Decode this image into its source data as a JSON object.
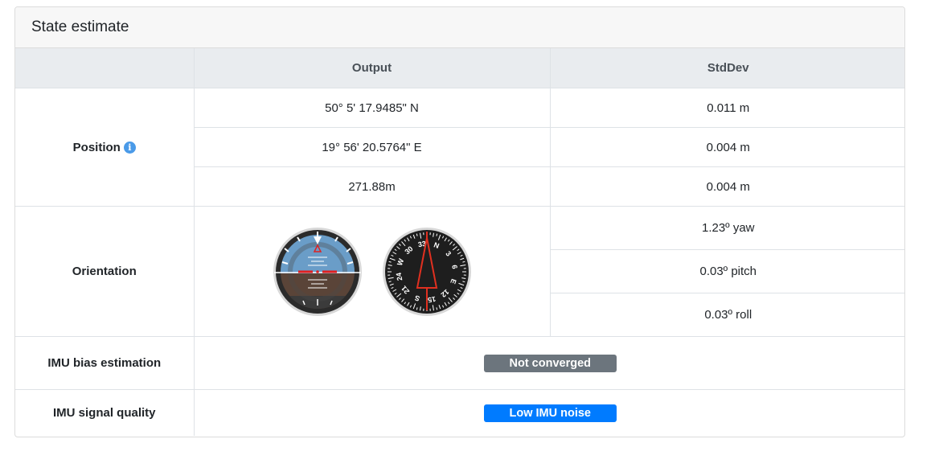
{
  "card": {
    "title": "State estimate"
  },
  "table": {
    "headers": [
      "",
      "Output",
      "StdDev"
    ],
    "position": {
      "label": "Position",
      "info_icon": "info-icon",
      "rows": [
        {
          "output": "50° 5' 17.9485\" N",
          "stddev": "0.011 m"
        },
        {
          "output": "19° 56' 20.5764\" E",
          "stddev": "0.004 m"
        },
        {
          "output": "271.88m",
          "stddev": "0.004 m"
        }
      ]
    },
    "orientation": {
      "label": "Orientation",
      "instruments": [
        "attitude-indicator-icon",
        "heading-indicator-icon"
      ],
      "compass_labels": [
        "N",
        "3",
        "6",
        "E",
        "12",
        "15",
        "S",
        "21",
        "24",
        "W",
        "30",
        "33"
      ],
      "rows": [
        {
          "stddev": "1.23º yaw"
        },
        {
          "stddev": "0.03º pitch"
        },
        {
          "stddev": "0.03º roll"
        }
      ]
    },
    "imu_bias": {
      "label": "IMU bias estimation",
      "status": "Not converged",
      "status_color": "#6c757d"
    },
    "imu_signal": {
      "label": "IMU signal quality",
      "status": "Low IMU noise",
      "status_color": "#007bff"
    }
  }
}
